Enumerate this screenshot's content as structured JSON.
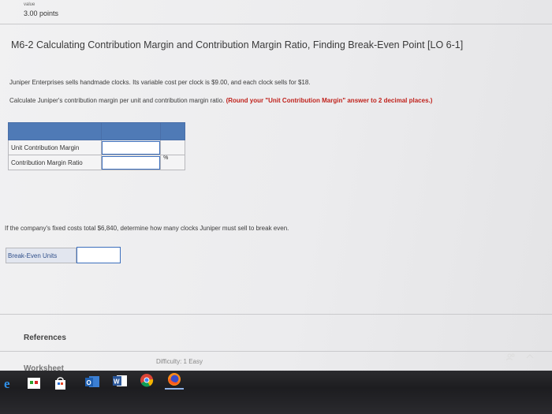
{
  "header": {
    "value_label": "value",
    "points": "3.00 points"
  },
  "question": {
    "title": "M6-2 Calculating Contribution Margin and Contribution Margin Ratio, Finding Break-Even Point [LO 6-1]",
    "intro": "Juniper Enterprises sells handmade clocks. Its variable cost per clock is $9.00, and each clock sells for $18.",
    "instruction": "Calculate Juniper's contribution margin per unit and contribution margin ratio.",
    "instruction_note": "(Round your \"Unit Contribution Margin\" answer to 2 decimal places.)",
    "table": {
      "rows": [
        {
          "label": "Unit Contribution Margin",
          "value": "",
          "unit": ""
        },
        {
          "label": "Contribution Margin Ratio",
          "value": "",
          "unit": "%"
        }
      ]
    },
    "part2_prompt": "If the company's fixed costs total $6,840, determine how many clocks Juniper must sell to break even.",
    "breakeven": {
      "label": "Break-Even Units",
      "value": ""
    }
  },
  "footer": {
    "references": "References",
    "worksheet": "Worksheet",
    "difficulty": "Difficulty: 1 Easy"
  },
  "taskbar": {
    "apps": [
      "edge-icon",
      "store-icon",
      "shopping-bag-icon",
      "outlook-icon",
      "word-icon",
      "chrome-icon",
      "firefox-icon"
    ],
    "tray": {
      "people": "people-icon",
      "chevron": "chevron-up-icon"
    }
  }
}
